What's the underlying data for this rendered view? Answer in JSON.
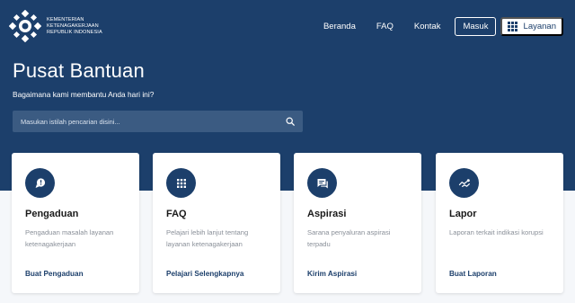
{
  "brand": {
    "line1": "KEMENTERIAN",
    "line2": "KETENAGAKERJAAN",
    "line3": "REPUBLIK INDONESIA"
  },
  "nav": {
    "beranda": "Beranda",
    "faq": "FAQ",
    "kontak": "Kontak",
    "masuk": "Masuk",
    "layanan": "Layanan"
  },
  "hero": {
    "title": "Pusat Bantuan",
    "subtitle": "Bagaimana kami membantu Anda hari ini?"
  },
  "search": {
    "placeholder": "Masukan istilah pencarian disini..."
  },
  "cards": [
    {
      "icon": "complaint-icon",
      "title": "Pengaduan",
      "desc": "Pengaduan masalah layanan ketenagakerjaan",
      "link": "Buat Pengaduan"
    },
    {
      "icon": "grid-icon",
      "title": "FAQ",
      "desc": "Pelajari lebih lanjut tentang layanan ketenagakerjaan",
      "link": "Pelajari Selengkapnya"
    },
    {
      "icon": "chat-icon",
      "title": "Aspirasi",
      "desc": "Sarana penyaluran aspirasi terpadu",
      "link": "Kirim Aspirasi"
    },
    {
      "icon": "report-icon",
      "title": "Lapor",
      "desc": "Laporan terkait indikasi korupsi",
      "link": "Buat Laporan"
    }
  ],
  "colors": {
    "primary": "#1c3f6b",
    "search_bg": "#3b5b82",
    "page_bg": "#f5f7fa"
  }
}
